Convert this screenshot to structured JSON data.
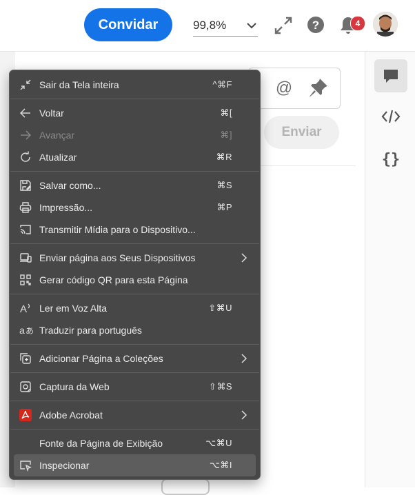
{
  "header": {
    "invite_label": "Convidar",
    "zoom_value": "99,8%",
    "notification_count": "4"
  },
  "comment": {
    "send_label": "Enviar"
  },
  "menu": {
    "items": [
      {
        "label": "Sair da Tela inteira",
        "shortcut": "^⌘F",
        "icon": "exit-fullscreen-icon"
      },
      {
        "label": "Voltar",
        "shortcut": "⌘[",
        "icon": "arrow-left-icon"
      },
      {
        "label": "Avançar",
        "shortcut": "⌘]",
        "icon": "arrow-right-icon",
        "disabled": true
      },
      {
        "label": "Atualizar",
        "shortcut": "⌘R",
        "icon": "refresh-icon"
      },
      {
        "label": "Salvar como...",
        "shortcut": "⌘S",
        "icon": "save-icon"
      },
      {
        "label": "Impressão...",
        "shortcut": "⌘P",
        "icon": "printer-icon"
      },
      {
        "label": "Transmitir Mídia para o Dispositivo...",
        "shortcut": "",
        "icon": "cast-icon"
      },
      {
        "label": "Enviar página aos Seus Dispositivos",
        "shortcut": "",
        "icon": "send-to-device-icon",
        "submenu": true
      },
      {
        "label": "Gerar código QR para esta Página",
        "shortcut": "",
        "icon": "qr-code-icon"
      },
      {
        "label": "Ler em Voz Alta",
        "shortcut": "⇧⌘U",
        "icon": "read-aloud-icon"
      },
      {
        "label": "Traduzir para português",
        "shortcut": "",
        "icon": "translate-icon"
      },
      {
        "label": "Adicionar Página a Coleções",
        "shortcut": "",
        "icon": "collections-icon",
        "submenu": true
      },
      {
        "label": "Captura da Web",
        "shortcut": "⇧⌘S",
        "icon": "web-capture-icon"
      },
      {
        "label": "Adobe Acrobat",
        "shortcut": "",
        "icon": "acrobat-icon",
        "submenu": true
      },
      {
        "label": "Fonte da Página de Exibição",
        "shortcut": "⌥⌘U",
        "icon": ""
      },
      {
        "label": "Inspecionar",
        "shortcut": "⌥⌘I",
        "icon": "inspect-icon",
        "highlighted": true
      }
    ]
  },
  "colors": {
    "accent": "#1473e6",
    "menu_bg": "#474747",
    "badge": "#d7373f",
    "acrobat": "#d5281d"
  }
}
